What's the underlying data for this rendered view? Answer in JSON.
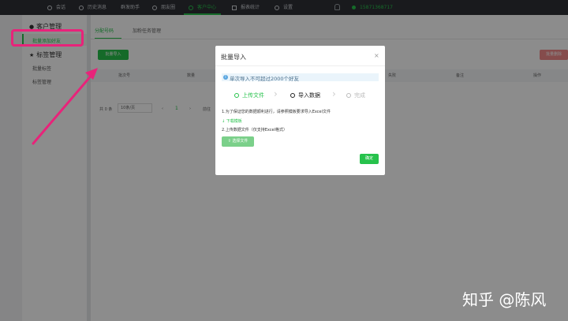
{
  "topnav": {
    "items": [
      {
        "label": "会话",
        "icon": "chat-icon"
      },
      {
        "label": "历史消息",
        "icon": "history-icon"
      },
      {
        "label": "群发助手",
        "icon": "broadcast-icon"
      },
      {
        "label": "朋友圈",
        "icon": "moments-icon"
      },
      {
        "label": "客户中心",
        "icon": "user-icon",
        "active": true
      },
      {
        "label": "报表统计",
        "icon": "bar-chart-icon"
      },
      {
        "label": "设置",
        "icon": "gear-icon"
      }
    ],
    "user_phone": "15871368717"
  },
  "sidebar": {
    "customer_section": "客户管理",
    "customer_items": [
      "批量添加好友"
    ],
    "tag_section": "标签管理",
    "tag_items": [
      "批量标签",
      "标签管理"
    ]
  },
  "main": {
    "tabs": [
      "分配号码",
      "加粉任务管理"
    ],
    "batch_import_button": "批量导入",
    "delete_button": "批量删除",
    "table_headers": [
      "批次号",
      "数量",
      "关联",
      "操作"
    ],
    "table_headers_more": [
      "失败",
      "备注"
    ],
    "pager": {
      "total": "共 0 条",
      "page_size": "10条/页",
      "page": "1",
      "goto": "前往"
    }
  },
  "modal": {
    "title": "批量导入",
    "close": "×",
    "info": "单次导入不可超过2000个好友",
    "steps": [
      "上传文件",
      "导入数据",
      "完成"
    ],
    "hint1": "1.为了保证您的数据顺利进行，请参照模板要求导入Excel文件",
    "download_link": "↓ 下载模板",
    "hint2": "2.上传数据文件（仅支持Excel格式）",
    "choose_file": "⇪ 选择文件",
    "confirm": "确定"
  },
  "watermark": "知乎 @陈风",
  "colors": {
    "accent": "#27c24c",
    "annotation": "#e8237a"
  }
}
